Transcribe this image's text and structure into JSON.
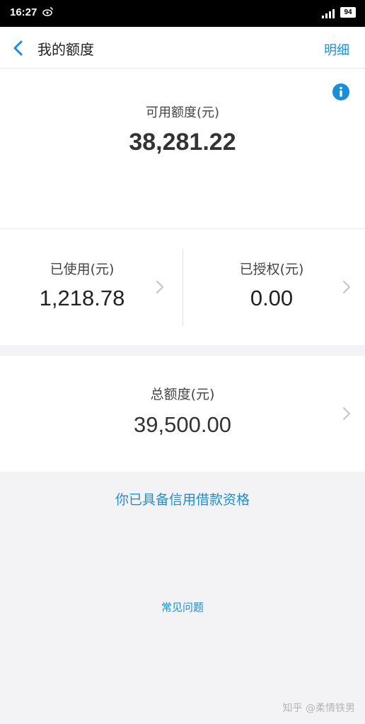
{
  "status_bar": {
    "time": "16:27",
    "carrier_icon": "weibo-icon",
    "battery": "94"
  },
  "header": {
    "back_icon": "chevron-left-icon",
    "title": "我的额度",
    "detail_label": "明细"
  },
  "available": {
    "label": "可用额度(元)",
    "value": "38,281.22",
    "info_icon": "info-icon"
  },
  "used": {
    "label": "已使用(元)",
    "value": "1,218.78"
  },
  "authorized": {
    "label": "已授权(元)",
    "value": "0.00"
  },
  "total": {
    "label": "总额度(元)",
    "value": "39,500.00"
  },
  "eligibility_text": "你已具备信用借款资格",
  "faq_label": "常见问题",
  "watermark": "知乎 @柔情铁男",
  "colors": {
    "accent": "#1890d8",
    "background": "#f3f3f5",
    "panel": "#ffffff"
  }
}
